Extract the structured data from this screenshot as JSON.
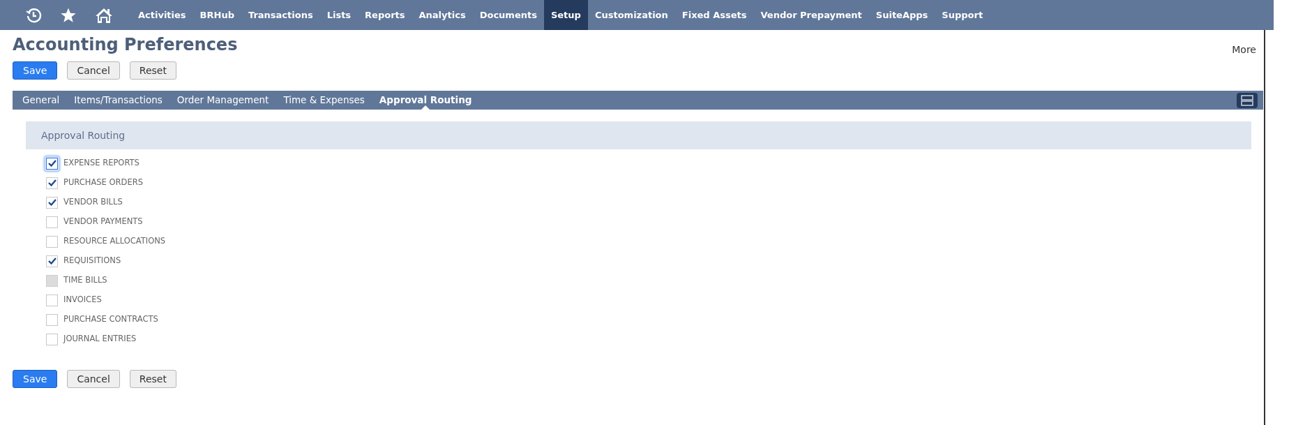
{
  "nav": {
    "items": [
      {
        "label": "Activities",
        "selected": false
      },
      {
        "label": "BRHub",
        "selected": false
      },
      {
        "label": "Transactions",
        "selected": false
      },
      {
        "label": "Lists",
        "selected": false
      },
      {
        "label": "Reports",
        "selected": false
      },
      {
        "label": "Analytics",
        "selected": false
      },
      {
        "label": "Documents",
        "selected": false
      },
      {
        "label": "Setup",
        "selected": true
      },
      {
        "label": "Customization",
        "selected": false
      },
      {
        "label": "Fixed Assets",
        "selected": false
      },
      {
        "label": "Vendor Prepayment",
        "selected": false
      },
      {
        "label": "SuiteApps",
        "selected": false
      },
      {
        "label": "Support",
        "selected": false
      }
    ]
  },
  "page": {
    "title": "Accounting Preferences",
    "more": "More"
  },
  "top_buttons": [
    {
      "label": "Save",
      "kind": "primary"
    },
    {
      "label": "Cancel",
      "kind": "secondary"
    },
    {
      "label": "Reset",
      "kind": "secondary"
    }
  ],
  "tabs": [
    {
      "label": "General",
      "selected": false
    },
    {
      "label": "Items/Transactions",
      "selected": false
    },
    {
      "label": "Order Management",
      "selected": false
    },
    {
      "label": "Time & Expenses",
      "selected": false
    },
    {
      "label": "Approval Routing",
      "selected": true
    }
  ],
  "section": {
    "title": "Approval Routing",
    "options": [
      {
        "label": "EXPENSE REPORTS",
        "checked": true,
        "disabled": false,
        "focused": true
      },
      {
        "label": "PURCHASE ORDERS",
        "checked": true,
        "disabled": false,
        "focused": false
      },
      {
        "label": "VENDOR BILLS",
        "checked": true,
        "disabled": false,
        "focused": false
      },
      {
        "label": "VENDOR PAYMENTS",
        "checked": false,
        "disabled": false,
        "focused": false
      },
      {
        "label": "RESOURCE ALLOCATIONS",
        "checked": false,
        "disabled": false,
        "focused": false
      },
      {
        "label": "REQUISITIONS",
        "checked": true,
        "disabled": false,
        "focused": false
      },
      {
        "label": "TIME BILLS",
        "checked": false,
        "disabled": true,
        "focused": false
      },
      {
        "label": "INVOICES",
        "checked": false,
        "disabled": false,
        "focused": false
      },
      {
        "label": "PURCHASE CONTRACTS",
        "checked": false,
        "disabled": false,
        "focused": false
      },
      {
        "label": "JOURNAL ENTRIES",
        "checked": false,
        "disabled": false,
        "focused": false
      }
    ]
  },
  "bottom_buttons": [
    {
      "label": "Save",
      "kind": "primary"
    },
    {
      "label": "Cancel",
      "kind": "secondary"
    },
    {
      "label": "Reset",
      "kind": "secondary"
    }
  ]
}
